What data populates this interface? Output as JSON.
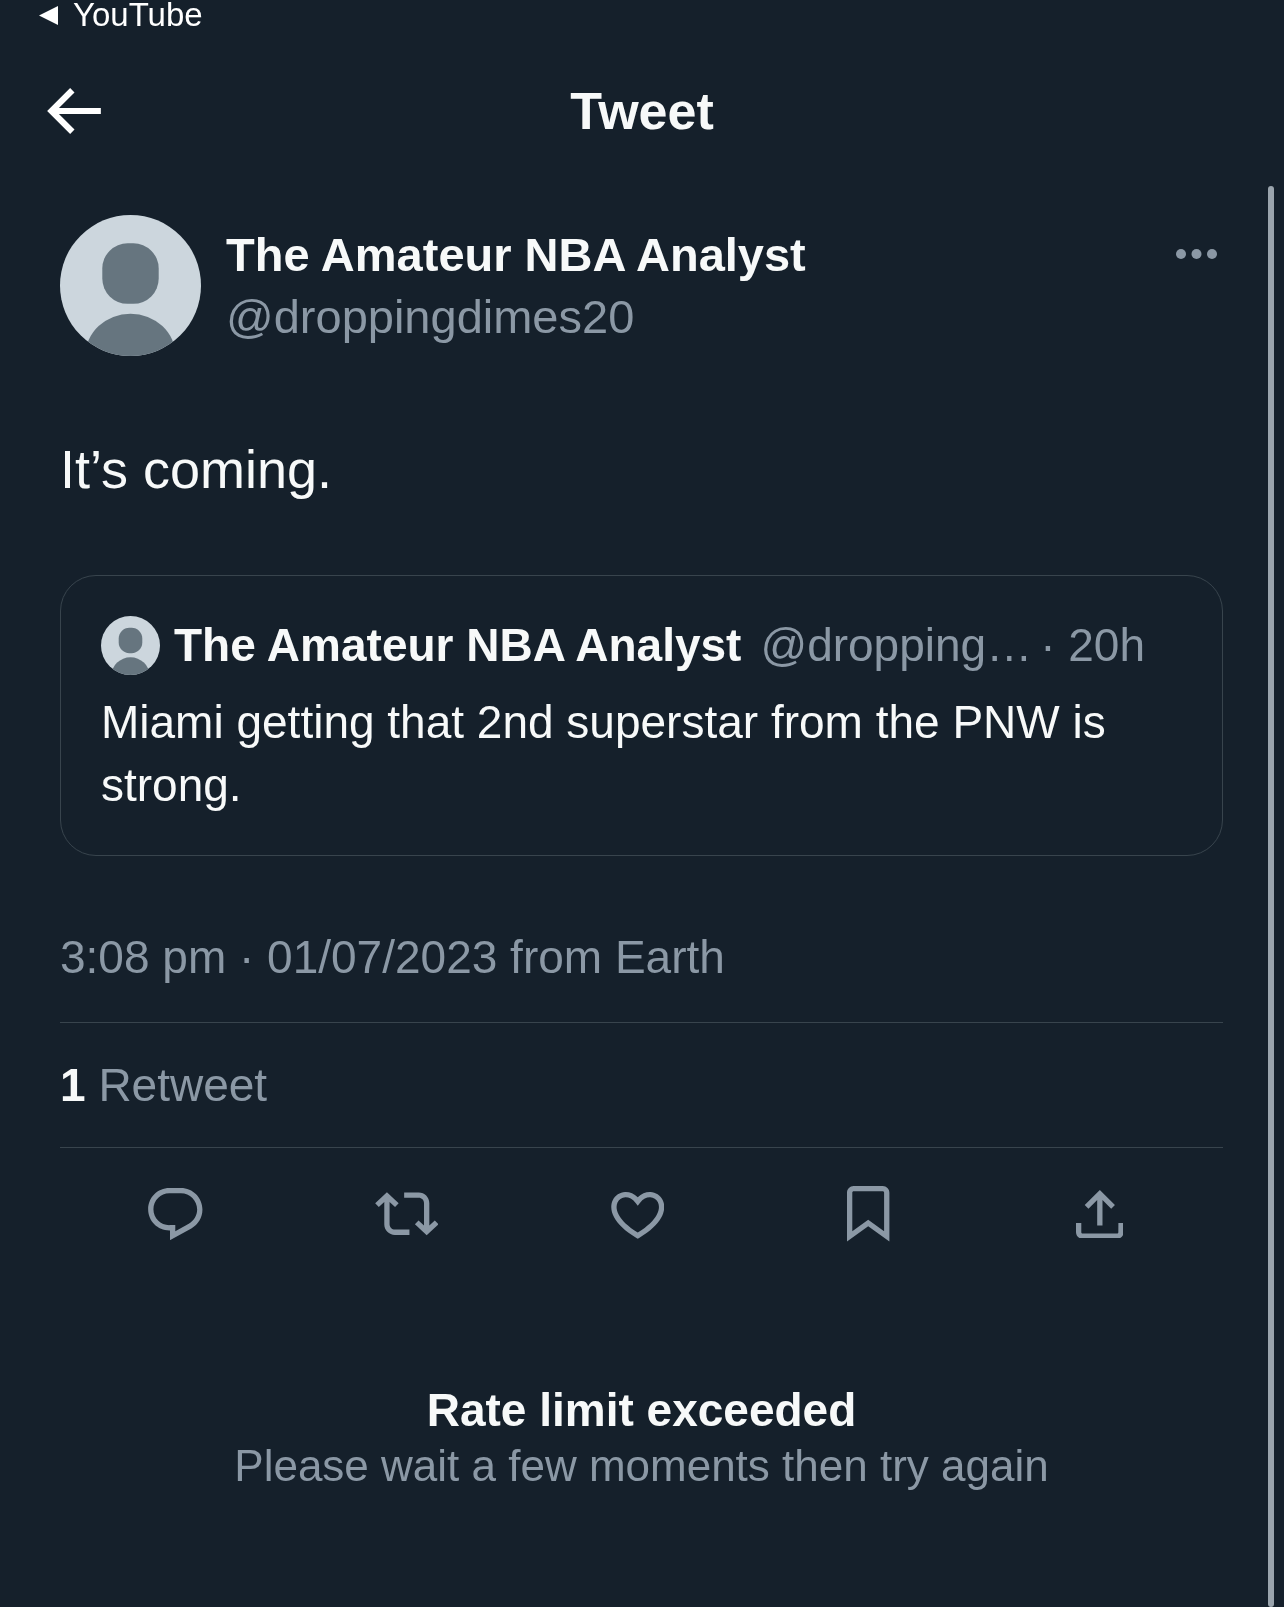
{
  "status_bar": {
    "back_app": "YouTube"
  },
  "header": {
    "title": "Tweet"
  },
  "tweet": {
    "author": {
      "name": "The Amateur NBA Analyst",
      "handle": "@droppingdimes20"
    },
    "text": "It’s coming.",
    "quoted_tweet": {
      "author": {
        "name": "The Amateur NBA Analyst",
        "handle": "@dropping…"
      },
      "time": "· 20h",
      "text": "Miami getting that 2nd superstar from the PNW is strong."
    },
    "timestamp": "3:08 pm · 01/07/2023 from Earth",
    "stats": [
      {
        "count": "1",
        "label": "Retweet"
      }
    ],
    "actions": [
      {
        "kind": "reply"
      },
      {
        "kind": "retweet"
      },
      {
        "kind": "like"
      },
      {
        "kind": "bookmark"
      },
      {
        "kind": "share"
      }
    ]
  },
  "error": {
    "title": "Rate limit exceeded",
    "message": "Please wait a few moments then try again"
  }
}
